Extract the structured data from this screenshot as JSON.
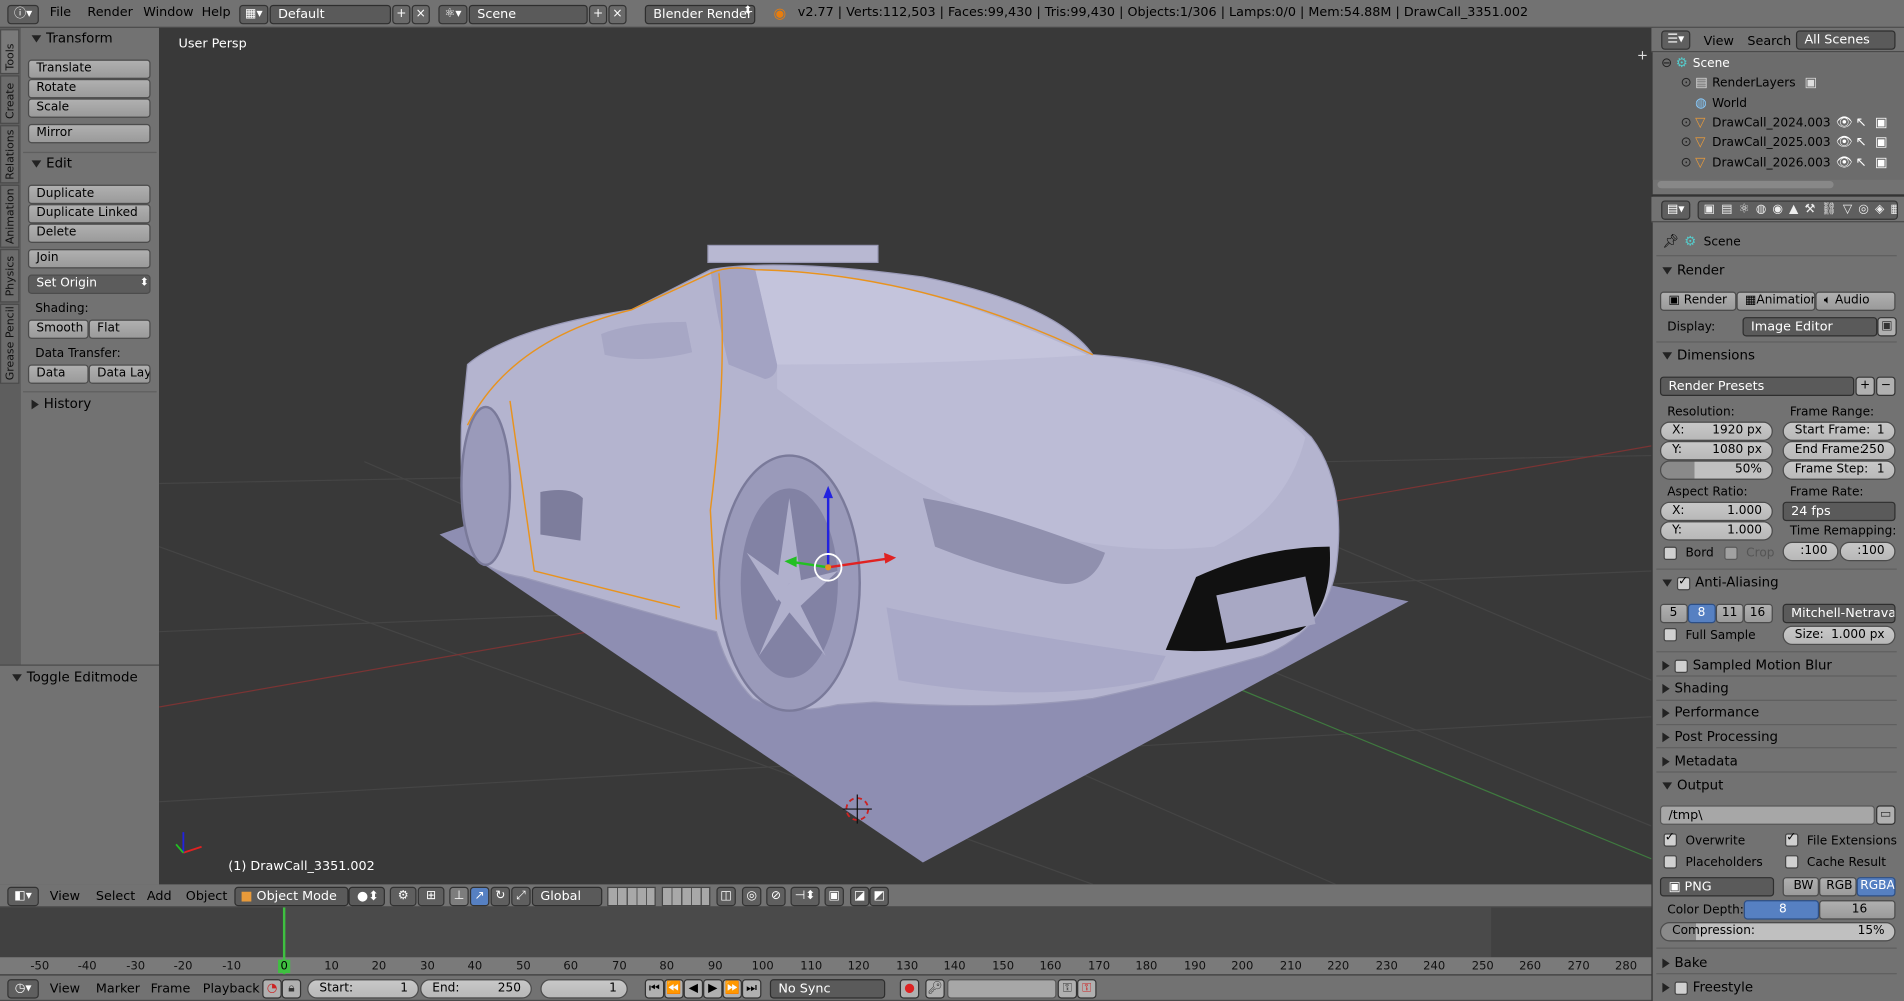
{
  "topbar": {
    "menus": [
      "File",
      "Render",
      "Window",
      "Help"
    ],
    "layout": "Default",
    "scene": "Scene",
    "engine": "Blender Render",
    "stats": "v2.77 | Verts:112,503 | Faces:99,430 | Tris:99,430 | Objects:1/306 | Lamps:0/0 | Mem:54.88M | DrawCall_3351.002"
  },
  "left_tabs": [
    "Tools",
    "Create",
    "Relations",
    "Animation",
    "Physics",
    "Grease Pencil"
  ],
  "tools": {
    "transform_title": "Transform",
    "translate": "Translate",
    "rotate": "Rotate",
    "scale": "Scale",
    "mirror": "Mirror",
    "edit_title": "Edit",
    "duplicate": "Duplicate",
    "duplicate_linked": "Duplicate Linked",
    "delete": "Delete",
    "join": "Join",
    "set_origin": "Set Origin",
    "shading_label": "Shading:",
    "smooth": "Smooth",
    "flat": "Flat",
    "data_transfer_label": "Data Transfer:",
    "data": "Data",
    "data_layo": "Data Layo",
    "history_title": "History",
    "toggle_editmode": "Toggle Editmode"
  },
  "viewport": {
    "view_label": "User Persp",
    "object_label": "(1) DrawCall_3351.002"
  },
  "viewport_header": {
    "menus": [
      "View",
      "Select",
      "Add",
      "Object"
    ],
    "mode": "Object Mode",
    "orientation": "Global"
  },
  "timeline": {
    "ticks": [
      "-50",
      "-40",
      "-30",
      "-20",
      "-10",
      "0",
      "10",
      "20",
      "30",
      "40",
      "50",
      "60",
      "70",
      "80",
      "90",
      "100",
      "110",
      "120",
      "130",
      "140",
      "150",
      "160",
      "170",
      "180",
      "190",
      "200",
      "210",
      "220",
      "230",
      "240",
      "250",
      "260",
      "270",
      "280"
    ],
    "current_frame": 1,
    "menus": [
      "View",
      "Marker",
      "Frame",
      "Playback"
    ],
    "start_label": "Start:",
    "start_value": "1",
    "end_label": "End:",
    "end_value": "250",
    "current_value": "1",
    "sync": "No Sync"
  },
  "outliner": {
    "header": {
      "view": "View",
      "search": "Search",
      "scope": "All Scenes"
    },
    "items": [
      "Scene",
      "RenderLayers",
      "World",
      "DrawCall_2024.003",
      "DrawCall_2025.003",
      "DrawCall_2026.003"
    ]
  },
  "properties": {
    "context": "Scene",
    "render": {
      "title": "Render",
      "render_btn": "Render",
      "animation_btn": "Animation",
      "audio_btn": "Audio",
      "display_label": "Display:",
      "display_value": "Image Editor"
    },
    "dimensions": {
      "title": "Dimensions",
      "presets": "Render Presets",
      "resolution_label": "Resolution:",
      "res_x_key": "X:",
      "res_x": "1920 px",
      "res_y_key": "Y:",
      "res_y": "1080 px",
      "res_pct": "50%",
      "frame_range_label": "Frame Range:",
      "start_key": "Start Frame:",
      "start": "1",
      "end_key": "End Frame:",
      "end": "250",
      "step_key": "Frame Step:",
      "step": "1",
      "aspect_label": "Aspect Ratio:",
      "asp_x_key": "X:",
      "asp_x": "1.000",
      "asp_y_key": "Y:",
      "asp_y": "1.000",
      "frame_rate_label": "Frame Rate:",
      "fps": "24 fps",
      "time_remap_label": "Time Remapping:",
      "remap_old": ":100",
      "remap_new": ":100",
      "bord": "Bord",
      "crop": "Crop"
    },
    "anti_aliasing": {
      "title": "Anti-Aliasing",
      "samples": [
        "5",
        "8",
        "11",
        "16"
      ],
      "filter": "Mitchell-Netravali",
      "full_sample": "Full Sample",
      "size_key": "Size:",
      "size": "1.000 px"
    },
    "collapsed_panels": [
      "Sampled Motion Blur",
      "Shading",
      "Performance",
      "Post Processing",
      "Metadata"
    ],
    "output": {
      "title": "Output",
      "path": "/tmp\\",
      "overwrite": "Overwrite",
      "file_extensions": "File Extensions",
      "placeholders": "Placeholders",
      "cache_result": "Cache Result",
      "format": "PNG",
      "bw": "BW",
      "rgb": "RGB",
      "rgba": "RGBA",
      "color_depth_label": "Color Depth:",
      "depth_8": "8",
      "depth_16": "16",
      "compression_key": "Compression:",
      "compression": "15%"
    },
    "bake": "Bake",
    "freestyle": "Freestyle"
  }
}
